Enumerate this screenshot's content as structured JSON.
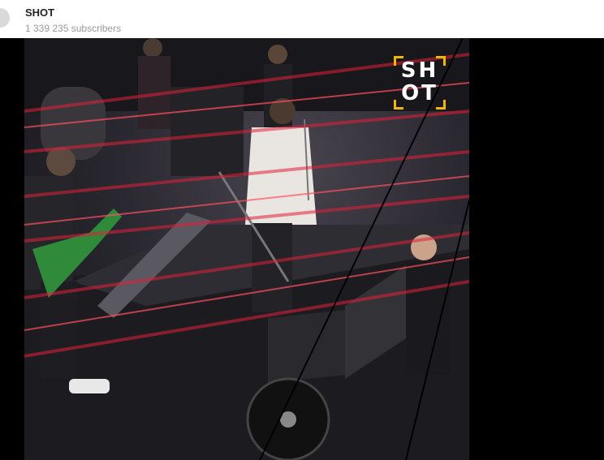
{
  "channel": {
    "name": "SHOT",
    "subscribers": "1 339 235 subscribers"
  },
  "video": {
    "watermark_line1": "SH",
    "watermark_line2": "OT"
  },
  "colors": {
    "watermark_frame": "#f2b705",
    "laser": "#e0203a"
  }
}
